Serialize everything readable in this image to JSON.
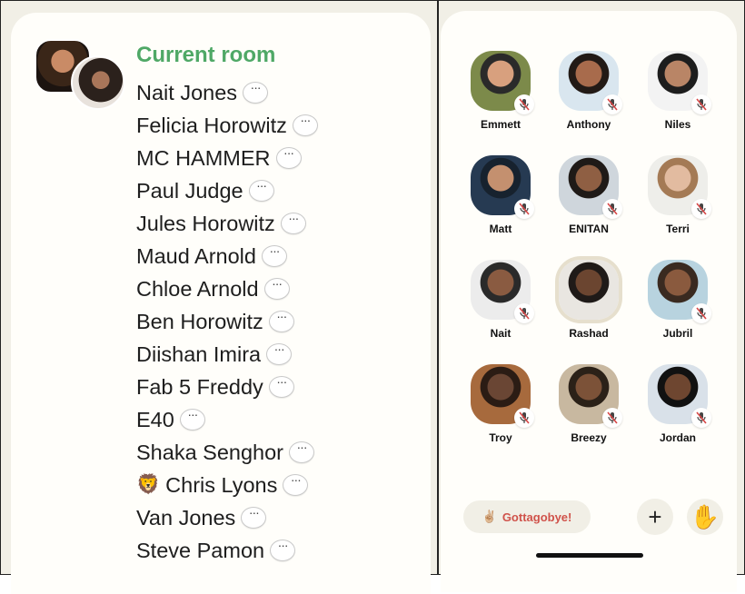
{
  "left_panel": {
    "title": "Current room",
    "names": [
      {
        "name": "Nait Jones",
        "emoji": ""
      },
      {
        "name": "Felicia Horowitz",
        "emoji": ""
      },
      {
        "name": "MC HAMMER",
        "emoji": ""
      },
      {
        "name": "Paul Judge",
        "emoji": ""
      },
      {
        "name": "Jules Horowitz",
        "emoji": ""
      },
      {
        "name": "Maud Arnold",
        "emoji": ""
      },
      {
        "name": "Chloe Arnold",
        "emoji": ""
      },
      {
        "name": "Ben Horowitz",
        "emoji": ""
      },
      {
        "name": "Diishan Imira",
        "emoji": ""
      },
      {
        "name": "Fab 5 Freddy",
        "emoji": ""
      },
      {
        "name": "E40",
        "emoji": ""
      },
      {
        "name": "Shaka Senghor",
        "emoji": ""
      },
      {
        "name": "Chris Lyons",
        "emoji": "🦁"
      },
      {
        "name": "Van Jones",
        "emoji": ""
      },
      {
        "name": "Steve Pamon",
        "emoji": ""
      }
    ]
  },
  "speakers": [
    {
      "name": "Emmett",
      "muted": true
    },
    {
      "name": "Anthony",
      "muted": true
    },
    {
      "name": "Niles",
      "muted": true
    },
    {
      "name": "Matt",
      "muted": true
    },
    {
      "name": "ENITAN",
      "muted": true
    },
    {
      "name": "Terri",
      "muted": true
    },
    {
      "name": "Nait",
      "muted": true
    },
    {
      "name": "Rashad",
      "muted": false
    },
    {
      "name": "Jubril",
      "muted": true
    },
    {
      "name": "Troy",
      "muted": true
    },
    {
      "name": "Breezy",
      "muted": true
    },
    {
      "name": "Jordan",
      "muted": true
    }
  ],
  "footer": {
    "leave_label": "Gottagobye!",
    "leave_emoji": "✌🏼",
    "plus_icon": "+",
    "hand_icon": "✋"
  },
  "colors": {
    "accent_green": "#4fa866",
    "leave_red": "#d0524a",
    "mute_red": "#d64545"
  }
}
